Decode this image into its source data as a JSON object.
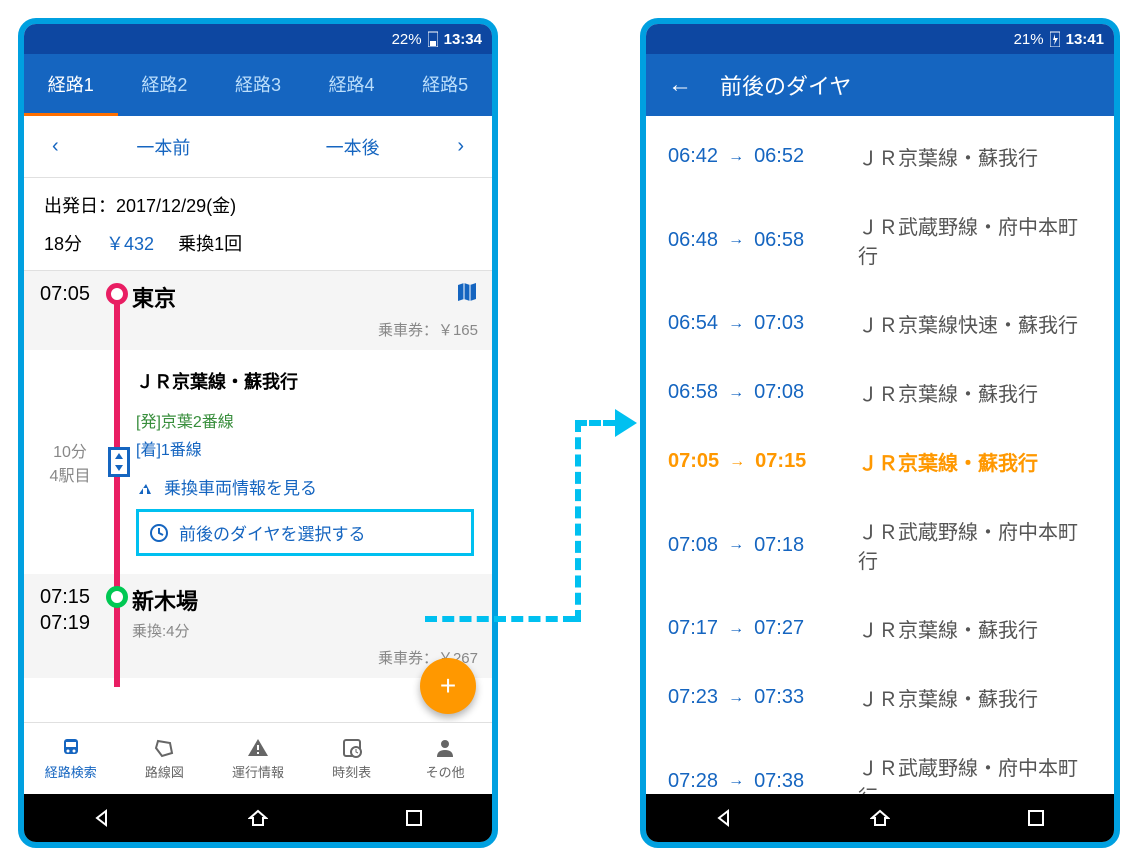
{
  "left": {
    "status": {
      "battery": "22%",
      "time": "13:34"
    },
    "tabs": [
      "経路1",
      "経路2",
      "経路3",
      "経路4",
      "経路5"
    ],
    "nav": {
      "prev": "一本前",
      "next": "一本後"
    },
    "summary": {
      "date_label": "出発日：2017/12/29(金)",
      "duration": "18分",
      "price": "￥432",
      "transfers": "乗換1回"
    },
    "stationA": {
      "time": "07:05",
      "name": "東京",
      "fare_label": "乗車券：￥165"
    },
    "segment1": {
      "duration": "10分",
      "ordinal": "4駅目",
      "line_name": "ＪＲ京葉線・蘇我行",
      "dep_platform": "[発]京葉2番線",
      "arr_platform": "[着]1番線",
      "transfer_link": "乗換車両情報を見る",
      "schedule_link": "前後のダイヤを選択する"
    },
    "stationB": {
      "time1": "07:15",
      "time2": "07:19",
      "name": "新木場",
      "transfer": "乗換:4分",
      "fare_label": "乗車券：￥267"
    },
    "botnav": [
      {
        "label": "経路検索"
      },
      {
        "label": "路線図"
      },
      {
        "label": "運行情報"
      },
      {
        "label": "時刻表"
      },
      {
        "label": "その他"
      }
    ]
  },
  "right": {
    "status": {
      "battery": "21%",
      "time": "13:41"
    },
    "title": "前後のダイヤ",
    "rows": [
      {
        "t1": "06:42",
        "t2": "06:52",
        "line": "ＪＲ京葉線・蘇我行"
      },
      {
        "t1": "06:48",
        "t2": "06:58",
        "line": "ＪＲ武蔵野線・府中本町行"
      },
      {
        "t1": "06:54",
        "t2": "07:03",
        "line": "ＪＲ京葉線快速・蘇我行"
      },
      {
        "t1": "06:58",
        "t2": "07:08",
        "line": "ＪＲ京葉線・蘇我行"
      },
      {
        "t1": "07:05",
        "t2": "07:15",
        "line": "ＪＲ京葉線・蘇我行",
        "highlight": true
      },
      {
        "t1": "07:08",
        "t2": "07:18",
        "line": "ＪＲ武蔵野線・府中本町行"
      },
      {
        "t1": "07:17",
        "t2": "07:27",
        "line": "ＪＲ京葉線・蘇我行"
      },
      {
        "t1": "07:23",
        "t2": "07:33",
        "line": "ＪＲ京葉線・蘇我行"
      },
      {
        "t1": "07:28",
        "t2": "07:38",
        "line": "ＪＲ武蔵野線・府中本町行"
      }
    ]
  }
}
